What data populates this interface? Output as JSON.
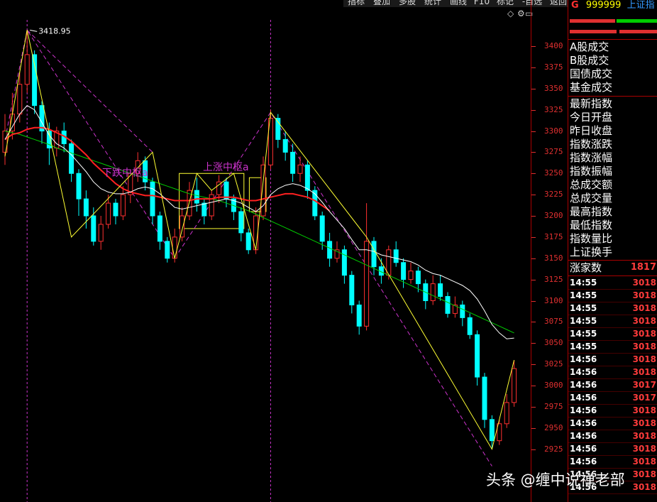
{
  "toolbar": {
    "buttons": [
      "指标",
      "叠加",
      "多股",
      "统计",
      "画线",
      "F10",
      "标记",
      "-自选",
      "返回"
    ]
  },
  "icons": {
    "diamond": "◇",
    "settings": "⚙",
    "restore": "▭"
  },
  "right_panel": {
    "code_prefix": "G",
    "code": "999999",
    "name": "上证指",
    "labels_group1": [
      "A股成交",
      "B股成交",
      "国债成交",
      "基金成交"
    ],
    "labels_group2": [
      "最新指数",
      "今日开盘",
      "昨日收盘",
      "指数涨跌",
      "指数涨幅",
      "指数振幅",
      "总成交额",
      "总成交量",
      "最高指数",
      "最低指数",
      "指数量比",
      "上证换手"
    ],
    "rise_label": "涨家数",
    "rise_value": "1817",
    "ticks": [
      {
        "time": "14:55",
        "value": "3018"
      },
      {
        "time": "14:55",
        "value": "3018"
      },
      {
        "time": "14:55",
        "value": "3018"
      },
      {
        "time": "14:55",
        "value": "3018"
      },
      {
        "time": "14:55",
        "value": "3018"
      },
      {
        "time": "14:55",
        "value": "3018"
      },
      {
        "time": "14:56",
        "value": "3018"
      },
      {
        "time": "14:56",
        "value": "3018"
      },
      {
        "time": "14:56",
        "value": "3017"
      },
      {
        "time": "14:56",
        "value": "3017"
      },
      {
        "time": "14:56",
        "value": "3018"
      },
      {
        "time": "14:56",
        "value": "3018"
      },
      {
        "time": "14:56",
        "value": "3018"
      },
      {
        "time": "14:56",
        "value": "3018"
      },
      {
        "time": "14:56",
        "value": "3018"
      },
      {
        "time": "14:56",
        "value": "3018"
      },
      {
        "time": "14:56",
        "value": "3018"
      }
    ]
  },
  "chart_data": {
    "type": "candlestick",
    "y_ticks": [
      3400,
      3375,
      3350,
      3325,
      3300,
      3275,
      3250,
      3225,
      3200,
      3175,
      3150,
      3125,
      3100,
      3075,
      3050,
      3025,
      3000,
      2975,
      2950,
      2925
    ],
    "ylim": [
      2900,
      3440
    ],
    "annotations": {
      "peak_label": "3418.95",
      "zone_down": "下跌中枢a",
      "zone_up": "上涨中枢a"
    },
    "colors": {
      "up": "#ff3030",
      "down": "#00ffff",
      "ma1": "#ffffff",
      "ma2": "#ff2020",
      "ma3": "#00cc00",
      "stroke": "#ffff33",
      "dash": "#cc33cc"
    },
    "candles": [
      [
        3275,
        3300,
        3320,
        3260
      ],
      [
        3300,
        3320,
        3345,
        3290
      ],
      [
        3320,
        3355,
        3370,
        3310
      ],
      [
        3355,
        3390,
        3418.95,
        3345
      ],
      [
        3390,
        3330,
        3395,
        3320
      ],
      [
        3330,
        3300,
        3335,
        3285
      ],
      [
        3300,
        3280,
        3310,
        3260
      ],
      [
        3280,
        3300,
        3305,
        3270
      ],
      [
        3300,
        3285,
        3310,
        3275
      ],
      [
        3285,
        3250,
        3290,
        3240
      ],
      [
        3250,
        3220,
        3255,
        3200
      ],
      [
        3220,
        3200,
        3230,
        3185
      ],
      [
        3200,
        3170,
        3210,
        3165
      ],
      [
        3170,
        3190,
        3200,
        3160
      ],
      [
        3190,
        3215,
        3225,
        3185
      ],
      [
        3215,
        3200,
        3220,
        3190
      ],
      [
        3200,
        3225,
        3235,
        3195
      ],
      [
        3225,
        3250,
        3255,
        3215
      ],
      [
        3250,
        3265,
        3275,
        3240
      ],
      [
        3265,
        3240,
        3270,
        3230
      ],
      [
        3240,
        3200,
        3245,
        3190
      ],
      [
        3200,
        3170,
        3205,
        3160
      ],
      [
        3170,
        3150,
        3175,
        3145
      ],
      [
        3150,
        3175,
        3185,
        3145
      ],
      [
        3175,
        3200,
        3210,
        3170
      ],
      [
        3200,
        3230,
        3240,
        3195
      ],
      [
        3230,
        3215,
        3245,
        3205
      ],
      [
        3215,
        3200,
        3220,
        3190
      ],
      [
        3200,
        3225,
        3230,
        3195
      ],
      [
        3225,
        3240,
        3248,
        3215
      ],
      [
        3240,
        3220,
        3245,
        3210
      ],
      [
        3220,
        3205,
        3225,
        3195
      ],
      [
        3205,
        3180,
        3210,
        3170
      ],
      [
        3180,
        3160,
        3185,
        3155
      ],
      [
        3160,
        3200,
        3210,
        3155
      ],
      [
        3200,
        3260,
        3270,
        3195
      ],
      [
        3260,
        3315,
        3325,
        3255
      ],
      [
        3315,
        3290,
        3320,
        3280
      ],
      [
        3290,
        3275,
        3300,
        3265
      ],
      [
        3275,
        3250,
        3285,
        3240
      ],
      [
        3250,
        3260,
        3270,
        3240
      ],
      [
        3260,
        3230,
        3265,
        3220
      ],
      [
        3230,
        3200,
        3235,
        3195
      ],
      [
        3200,
        3170,
        3205,
        3160
      ],
      [
        3170,
        3150,
        3180,
        3140
      ],
      [
        3150,
        3160,
        3170,
        3145
      ],
      [
        3160,
        3130,
        3165,
        3120
      ],
      [
        3130,
        3095,
        3135,
        3085
      ],
      [
        3095,
        3070,
        3100,
        3060
      ],
      [
        3070,
        3170,
        3215,
        3065
      ],
      [
        3170,
        3140,
        3175,
        3130
      ],
      [
        3140,
        3130,
        3150,
        3120
      ],
      [
        3130,
        3160,
        3165,
        3125
      ],
      [
        3160,
        3145,
        3170,
        3140
      ],
      [
        3145,
        3125,
        3150,
        3115
      ],
      [
        3125,
        3135,
        3145,
        3120
      ],
      [
        3135,
        3120,
        3140,
        3110
      ],
      [
        3120,
        3100,
        3125,
        3090
      ],
      [
        3100,
        3120,
        3130,
        3095
      ],
      [
        3120,
        3105,
        3130,
        3100
      ],
      [
        3105,
        3085,
        3110,
        3080
      ],
      [
        3085,
        3095,
        3105,
        3080
      ],
      [
        3095,
        3080,
        3100,
        3070
      ],
      [
        3080,
        3060,
        3085,
        3055
      ],
      [
        3060,
        3010,
        3065,
        3000
      ],
      [
        3010,
        2960,
        3015,
        2950
      ],
      [
        2960,
        2935,
        2965,
        2925
      ],
      [
        2935,
        2955,
        2960,
        2930
      ],
      [
        2955,
        2980,
        2990,
        2950
      ],
      [
        2980,
        3020,
        3030,
        2975
      ]
    ],
    "ma1": [
      3290,
      3305,
      3320,
      3330,
      3325,
      3310,
      3295,
      3285,
      3280,
      3272,
      3262,
      3252,
      3240,
      3232,
      3228,
      3226,
      3226,
      3228,
      3232,
      3234,
      3232,
      3226,
      3218,
      3210,
      3208,
      3210,
      3212,
      3214,
      3216,
      3218,
      3220,
      3218,
      3215,
      3210,
      3205,
      3212,
      3225,
      3232,
      3236,
      3238,
      3236,
      3232,
      3226,
      3216,
      3205,
      3195,
      3185,
      3172,
      3160,
      3160,
      3158,
      3154,
      3152,
      3150,
      3148,
      3146,
      3142,
      3136,
      3132,
      3130,
      3126,
      3122,
      3118,
      3112,
      3102,
      3088,
      3072,
      3062,
      3055,
      3056
    ],
    "ma2": [
      3290,
      3296,
      3298,
      3302,
      3304,
      3304,
      3302,
      3298,
      3294,
      3288,
      3280,
      3272,
      3262,
      3254,
      3246,
      3238,
      3232,
      3228,
      3226,
      3224,
      3224,
      3222,
      3220,
      3218,
      3218,
      3218,
      3220,
      3220,
      3220,
      3222,
      3222,
      3222,
      3220,
      3218,
      3218,
      3220,
      3222,
      3224,
      3226,
      3226,
      3224,
      3222,
      3218,
      3212,
      3206
    ],
    "ma3": [
      3300,
      3298,
      3296,
      3293,
      3290,
      3287,
      3284,
      3280,
      3277,
      3274,
      3271,
      3268,
      3265,
      3262,
      3259,
      3256,
      3253,
      3250,
      3247,
      3244,
      3241,
      3238,
      3235,
      3232,
      3229,
      3226,
      3224,
      3222,
      3220,
      3218,
      3215,
      3212,
      3209,
      3206,
      3202,
      3198,
      3194,
      3190,
      3186,
      3182,
      3178,
      3174,
      3170,
      3166,
      3162,
      3158,
      3154,
      3150,
      3146,
      3142,
      3138,
      3134,
      3130,
      3126,
      3122,
      3118,
      3114,
      3110,
      3106,
      3102,
      3098,
      3094,
      3090,
      3086,
      3082,
      3078,
      3074,
      3070,
      3066,
      3062
    ],
    "stroke_points": [
      [
        0,
        3270
      ],
      [
        3,
        3418.95
      ],
      [
        9,
        3175
      ],
      [
        20,
        3275
      ],
      [
        23,
        3150
      ],
      [
        26,
        3250
      ],
      [
        28,
        3230
      ],
      [
        31,
        3250
      ],
      [
        34,
        3160
      ],
      [
        36,
        3322
      ],
      [
        49,
        3175
      ],
      [
        66,
        2925
      ],
      [
        69,
        3030
      ]
    ],
    "dash_lines": [
      [
        [
          0,
          3290
        ],
        [
          3,
          3418.95
        ],
        [
          23,
          3150
        ],
        [
          36,
          3322
        ],
        [
          66,
          2905
        ]
      ]
    ],
    "zones": [
      {
        "i0": 24,
        "i1": 32,
        "lo": 3185,
        "hi": 3250
      },
      {
        "i0": 33.5,
        "i1": 35,
        "lo": 3205,
        "hi": 3245
      }
    ]
  }
}
